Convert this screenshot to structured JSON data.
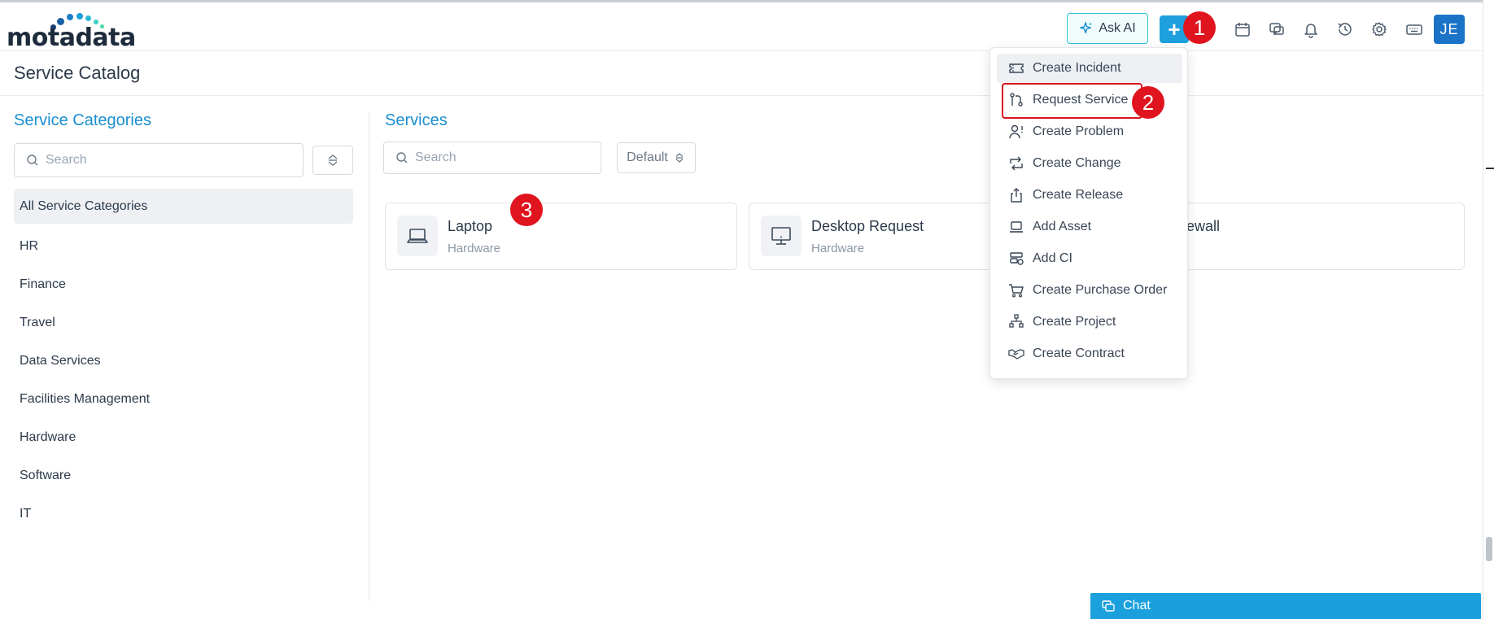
{
  "app": {
    "logo_text": "motadata",
    "page_title": "Service Catalog"
  },
  "header": {
    "ask_ai_label": "Ask AI",
    "plus_label": "+",
    "avatar_initials": "JE",
    "icons": [
      "calendar-icon",
      "chat-icon",
      "bell-icon",
      "history-icon",
      "gear-icon",
      "keyboard-icon"
    ]
  },
  "categories": {
    "title": "Service Categories",
    "search_placeholder": "Search",
    "items": [
      {
        "label": "All Service Categories",
        "active": true
      },
      {
        "label": "HR"
      },
      {
        "label": "Finance"
      },
      {
        "label": "Travel"
      },
      {
        "label": "Data Services"
      },
      {
        "label": "Facilities Management"
      },
      {
        "label": "Hardware"
      },
      {
        "label": "Software"
      },
      {
        "label": "IT"
      }
    ]
  },
  "services": {
    "title": "Services",
    "search_placeholder": "Search",
    "sort_label": "Default",
    "cards": [
      {
        "name": "Laptop",
        "category": "Hardware",
        "icon": "laptop-icon"
      },
      {
        "name": "Desktop Request",
        "category": "Hardware",
        "icon": "desktop-icon"
      },
      {
        "name": "rewall",
        "category": "",
        "icon": ""
      }
    ]
  },
  "create_menu": {
    "items": [
      {
        "label": "Create Incident",
        "icon": "ticket-icon"
      },
      {
        "label": "Request Service",
        "icon": "request-icon"
      },
      {
        "label": "Create Problem",
        "icon": "problem-icon"
      },
      {
        "label": "Create Change",
        "icon": "change-icon"
      },
      {
        "label": "Create Release",
        "icon": "release-icon"
      },
      {
        "label": "Add Asset",
        "icon": "asset-icon"
      },
      {
        "label": "Add CI",
        "icon": "ci-icon"
      },
      {
        "label": "Create Purchase Order",
        "icon": "cart-icon"
      },
      {
        "label": "Create Project",
        "icon": "project-icon"
      },
      {
        "label": "Create Contract",
        "icon": "handshake-icon"
      }
    ]
  },
  "annotations": {
    "badge_1": "1",
    "badge_2": "2",
    "badge_3": "3"
  },
  "chat": {
    "label": "Chat"
  },
  "colors": {
    "accent": "#1a8ed0",
    "primary_button": "#1ea0dc",
    "badge": "#e0141e",
    "avatar": "#1a73c7"
  }
}
